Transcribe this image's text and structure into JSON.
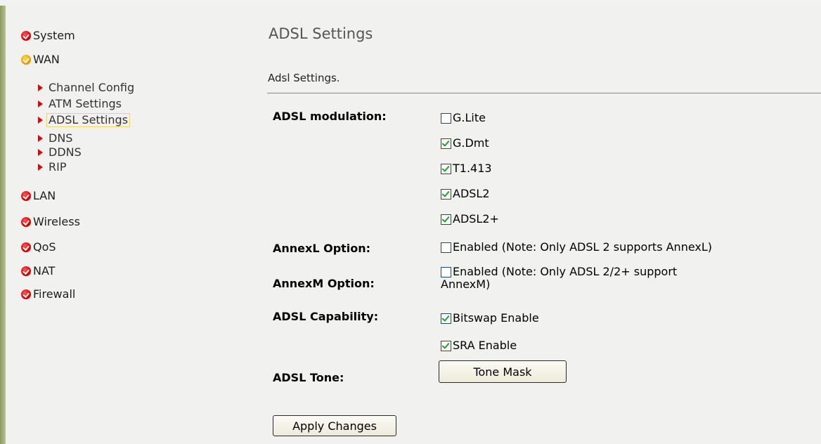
{
  "sidebar": {
    "items": [
      {
        "label": "System"
      },
      {
        "label": "WAN"
      },
      {
        "label": "LAN"
      },
      {
        "label": "Wireless"
      },
      {
        "label": "QoS"
      },
      {
        "label": "NAT"
      },
      {
        "label": "Firewall"
      }
    ],
    "wan_subitems": [
      {
        "label": "Channel Config"
      },
      {
        "label": "ATM Settings"
      },
      {
        "label": "ADSL Settings",
        "selected": true
      },
      {
        "label": "DNS"
      },
      {
        "label": "DDNS"
      },
      {
        "label": "RIP"
      }
    ]
  },
  "main": {
    "title": "ADSL Settings",
    "description": "Adsl Settings.",
    "modulation": {
      "label": "ADSL modulation:",
      "options": [
        {
          "label": "G.Lite",
          "checked": false
        },
        {
          "label": "G.Dmt",
          "checked": true
        },
        {
          "label": "T1.413",
          "checked": true
        },
        {
          "label": "ADSL2",
          "checked": true
        },
        {
          "label": "ADSL2+",
          "checked": true
        }
      ]
    },
    "annexl": {
      "label": "AnnexL Option:",
      "option": "Enabled (Note: Only ADSL 2 supports AnnexL)",
      "checked": false
    },
    "annexm": {
      "label": "AnnexM Option:",
      "option_line1": "Enabled (Note: Only ADSL 2/2+ support",
      "option_line2": "AnnexM)",
      "checked": false
    },
    "capability": {
      "label": "ADSL Capability:",
      "options": [
        {
          "label": "Bitswap Enable",
          "checked": true
        },
        {
          "label": "SRA Enable",
          "checked": true
        }
      ]
    },
    "tone": {
      "label": "ADSL Tone:",
      "button": "Tone Mask"
    },
    "apply_button": "Apply Changes"
  }
}
